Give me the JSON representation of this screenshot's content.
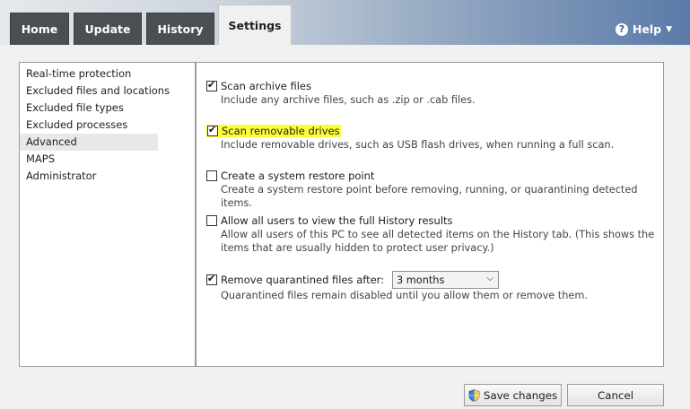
{
  "tabs": [
    {
      "label": "Home"
    },
    {
      "label": "Update"
    },
    {
      "label": "History"
    },
    {
      "label": "Settings",
      "active": true
    }
  ],
  "help": {
    "label": "Help",
    "icon": "question-circle-icon"
  },
  "sidebar": {
    "items": [
      {
        "label": "Real-time protection"
      },
      {
        "label": "Excluded files and locations"
      },
      {
        "label": "Excluded file types"
      },
      {
        "label": "Excluded processes"
      },
      {
        "label": "Advanced",
        "selected": true
      },
      {
        "label": "MAPS"
      },
      {
        "label": "Administrator"
      }
    ]
  },
  "options": [
    {
      "title": "Scan archive files",
      "checked": true,
      "desc": "Include any archive files, such as .zip or .cab files."
    },
    {
      "title": "Scan removable drives",
      "checked": true,
      "highlighted": true,
      "desc": "Include removable drives, such as USB flash drives, when running a full scan."
    },
    {
      "title": "Create a system restore point",
      "checked": false,
      "desc": "Create a system restore point before removing, running, or quarantining detected items."
    },
    {
      "title": "Allow all users to view the full History results",
      "checked": false,
      "desc": "Allow all users of this PC to see all detected items on the History tab. (This shows the items that are usually hidden to protect user privacy.)"
    },
    {
      "title": "Remove quarantined files after:",
      "checked": true,
      "desc": "Quarantined files remain disabled until you allow them or remove them."
    }
  ],
  "quarantine_dropdown": {
    "value": "3 months"
  },
  "buttons": {
    "save_label": "Save changes",
    "cancel_label": "Cancel"
  },
  "colors": {
    "highlight": "#fdfd3c",
    "tab_bg": "#4b4f54",
    "banner_right": "#5a7aa8"
  }
}
